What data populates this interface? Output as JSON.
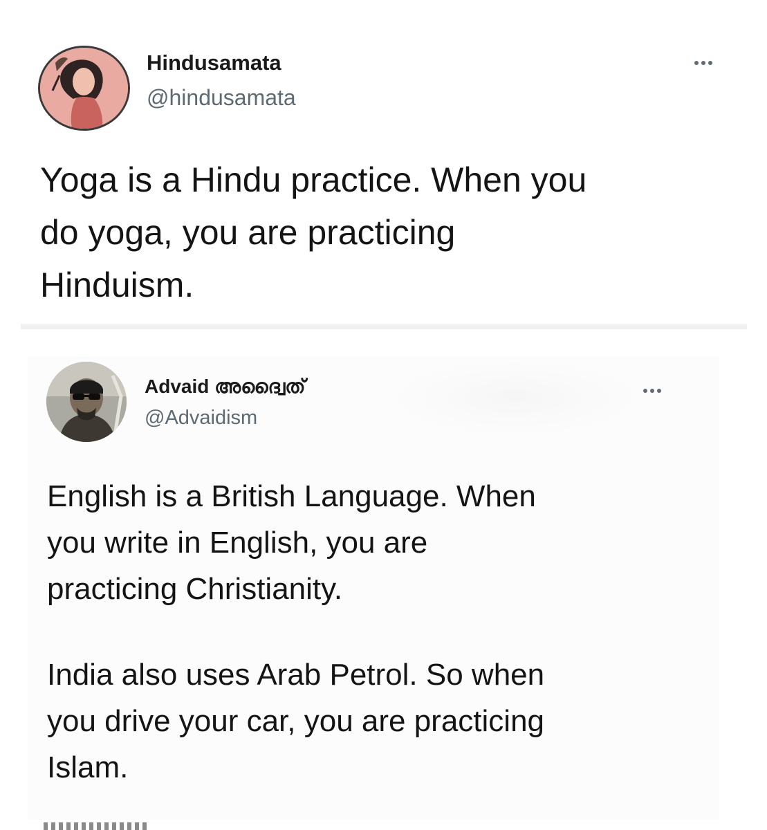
{
  "tweets": [
    {
      "display_name": "Hindusamata",
      "handle": "@hindusamata",
      "avatar": "profile-illustration",
      "lines": [
        "Yoga is a Hindu practice. When you",
        "do yoga, you are practicing",
        "Hinduism."
      ]
    },
    {
      "display_name": "Advaid അദ്വൈത്",
      "handle": "@Advaidism",
      "avatar": "profile-photo-sunglasses",
      "paragraphs": [
        {
          "lines": [
            "English is a British Language. When",
            "you write in English, you are",
            "practicing Christianity."
          ]
        },
        {
          "lines": [
            "India also uses Arab Petrol. So when",
            "you drive your car, you are practicing",
            "Islam."
          ]
        }
      ]
    }
  ],
  "icons": {
    "more": "more-options-icon"
  }
}
